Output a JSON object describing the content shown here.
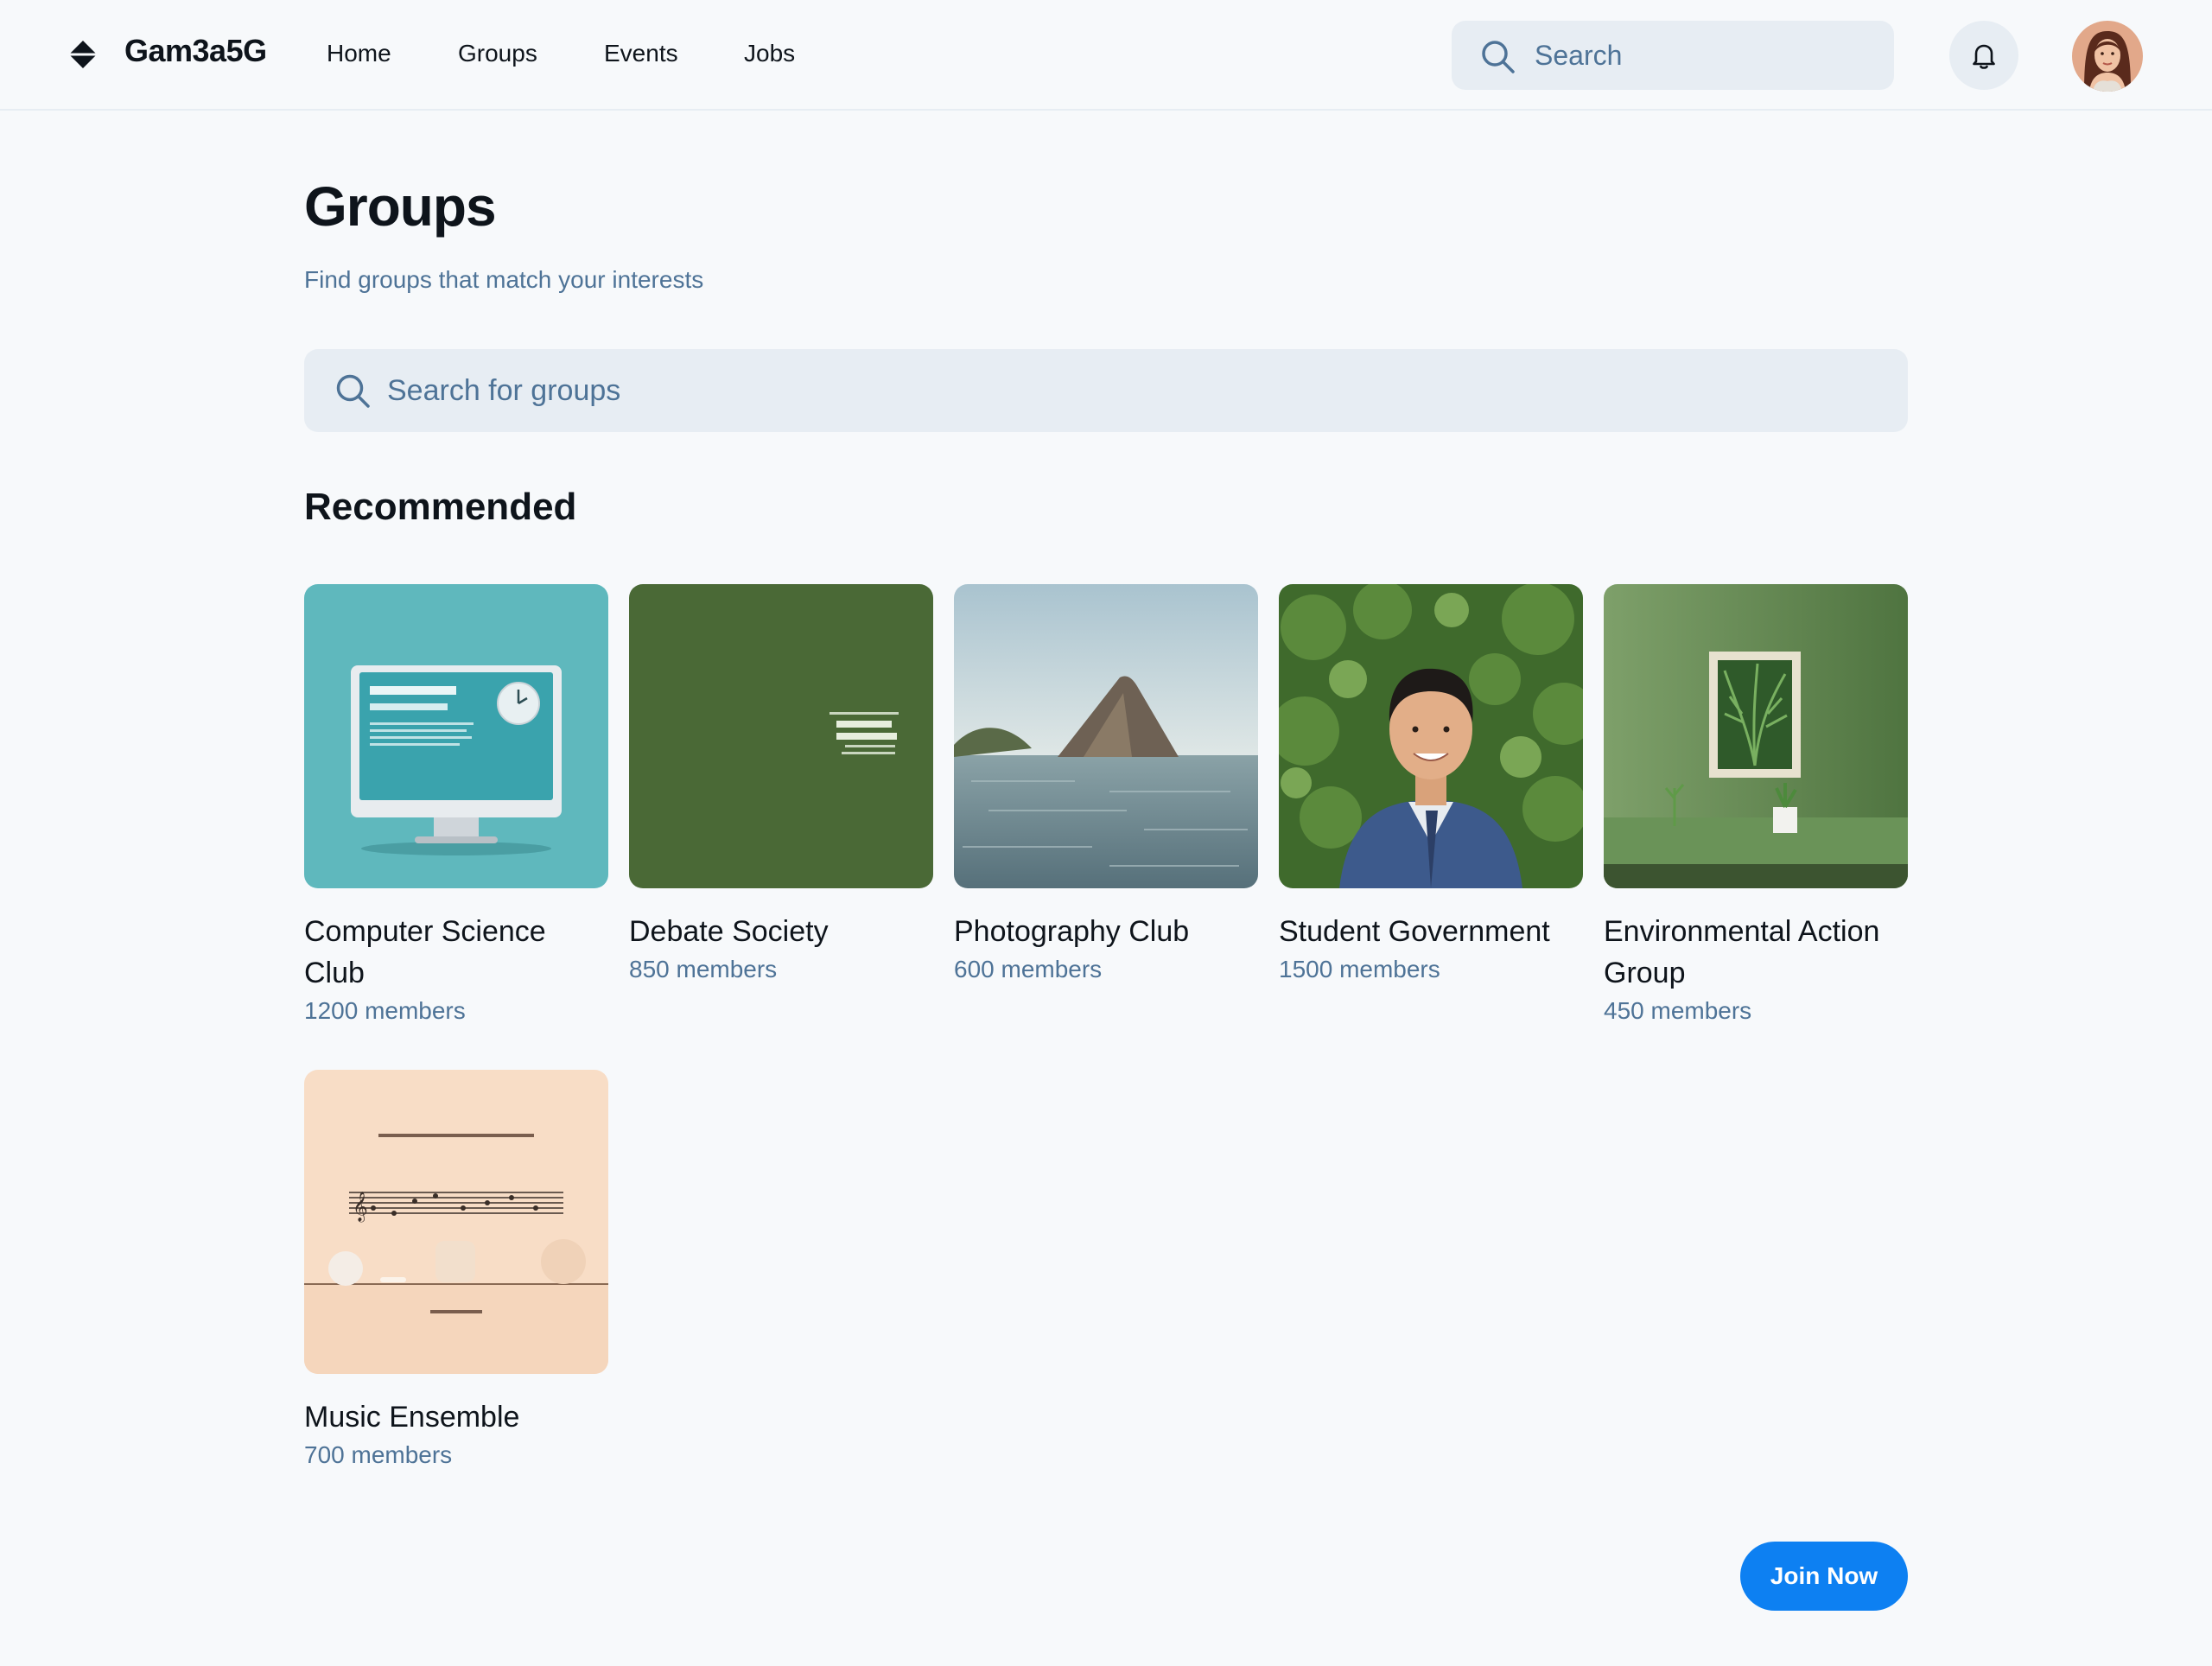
{
  "header": {
    "brand": "Gam3a5G",
    "nav": [
      "Home",
      "Groups",
      "Events",
      "Jobs"
    ],
    "search_placeholder": "Search"
  },
  "main": {
    "title": "Groups",
    "subtitle": "Find groups that match your interests",
    "search_placeholder": "Search for groups",
    "section_title": "Recommended",
    "groups": [
      {
        "name": "Computer Science Club",
        "members": "1200 members",
        "image": "computer-monitor-image"
      },
      {
        "name": "Debate Society",
        "members": "850 members",
        "image": "green-poster-image"
      },
      {
        "name": "Photography Club",
        "members": "600 members",
        "image": "sea-rock-image"
      },
      {
        "name": "Student Government",
        "members": "1500 members",
        "image": "student-portrait-image"
      },
      {
        "name": "Environmental Action Group",
        "members": "450 members",
        "image": "framed-plant-image"
      },
      {
        "name": "Music Ensemble",
        "members": "700 members",
        "image": "music-sheet-image"
      }
    ],
    "join_label": "Join Now"
  },
  "colors": {
    "background": "#f7f9fb",
    "input_bg": "#e7edf3",
    "muted_text": "#4e7397",
    "primary": "#0d80f2"
  }
}
